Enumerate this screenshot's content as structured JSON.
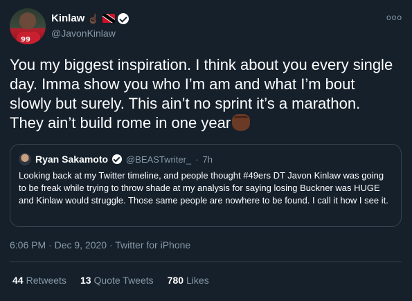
{
  "author": {
    "display_name": "Kinlaw",
    "handle": "@JavonKinlaw",
    "avatar_jersey_number": "99"
  },
  "tweet": {
    "text": "You my biggest inspiration. I think about you every single day. Imma show you who I’m am and what I’m bout slowly but surely. This ain’t no sprint it’s a marathon. They ain’t build rome in one year"
  },
  "quoted": {
    "display_name": "Ryan Sakamoto",
    "handle": "@BEASTwriter_",
    "separator": "·",
    "time": "7h",
    "text": "Looking back at my Twitter timeline, and people thought #49ers DT Javon Kinlaw was going to be freak while trying to throw shade at my analysis for saying losing Buckner was HUGE and Kinlaw would struggle. Those same people are nowhere to be found. I call it how I see it."
  },
  "meta": {
    "timestamp": "6:06 PM · Dec 9, 2020 · Twitter for iPhone"
  },
  "stats": [
    {
      "count": "44",
      "label": "Retweets"
    },
    {
      "count": "13",
      "label": "Quote Tweets"
    },
    {
      "count": "780",
      "label": "Likes"
    }
  ],
  "icons": {
    "more": "ooo",
    "hand": "☝🏿"
  }
}
